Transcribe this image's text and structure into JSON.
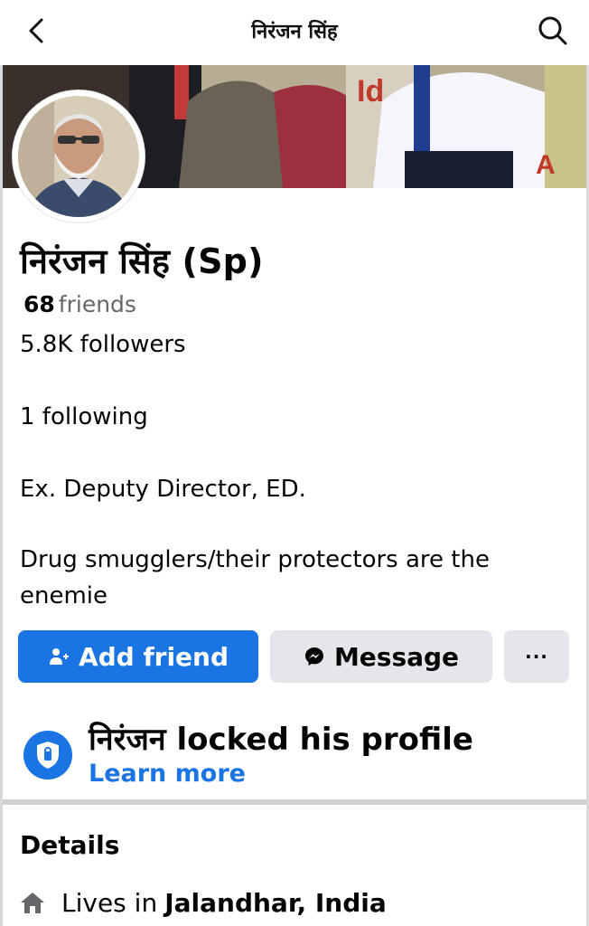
{
  "header": {
    "title": "निरंजन सिंह",
    "back_icon": "back-arrow-icon",
    "search_icon": "search-icon"
  },
  "profile": {
    "name": "निरंजन सिंह (Sp)",
    "friends_count": "68",
    "friends_label": "friends",
    "followers": "5.8K followers",
    "following": "1 following",
    "bio_line1": "Ex. Deputy Director, ED.",
    "bio_line2": "Drug smugglers/their protectors are the",
    "bio_line3": "enemie"
  },
  "actions": {
    "add_friend": "Add friend",
    "message": "Message",
    "more": "···"
  },
  "locked": {
    "text": "निरंजन locked his profile",
    "link": "Learn more"
  },
  "details": {
    "heading": "Details",
    "lives_prefix": "Lives in",
    "lives_place": "Jalandhar, India"
  },
  "colors": {
    "accent": "#1b74e4",
    "secondary_button": "#e4e6eb",
    "muted_text": "#65676b"
  }
}
